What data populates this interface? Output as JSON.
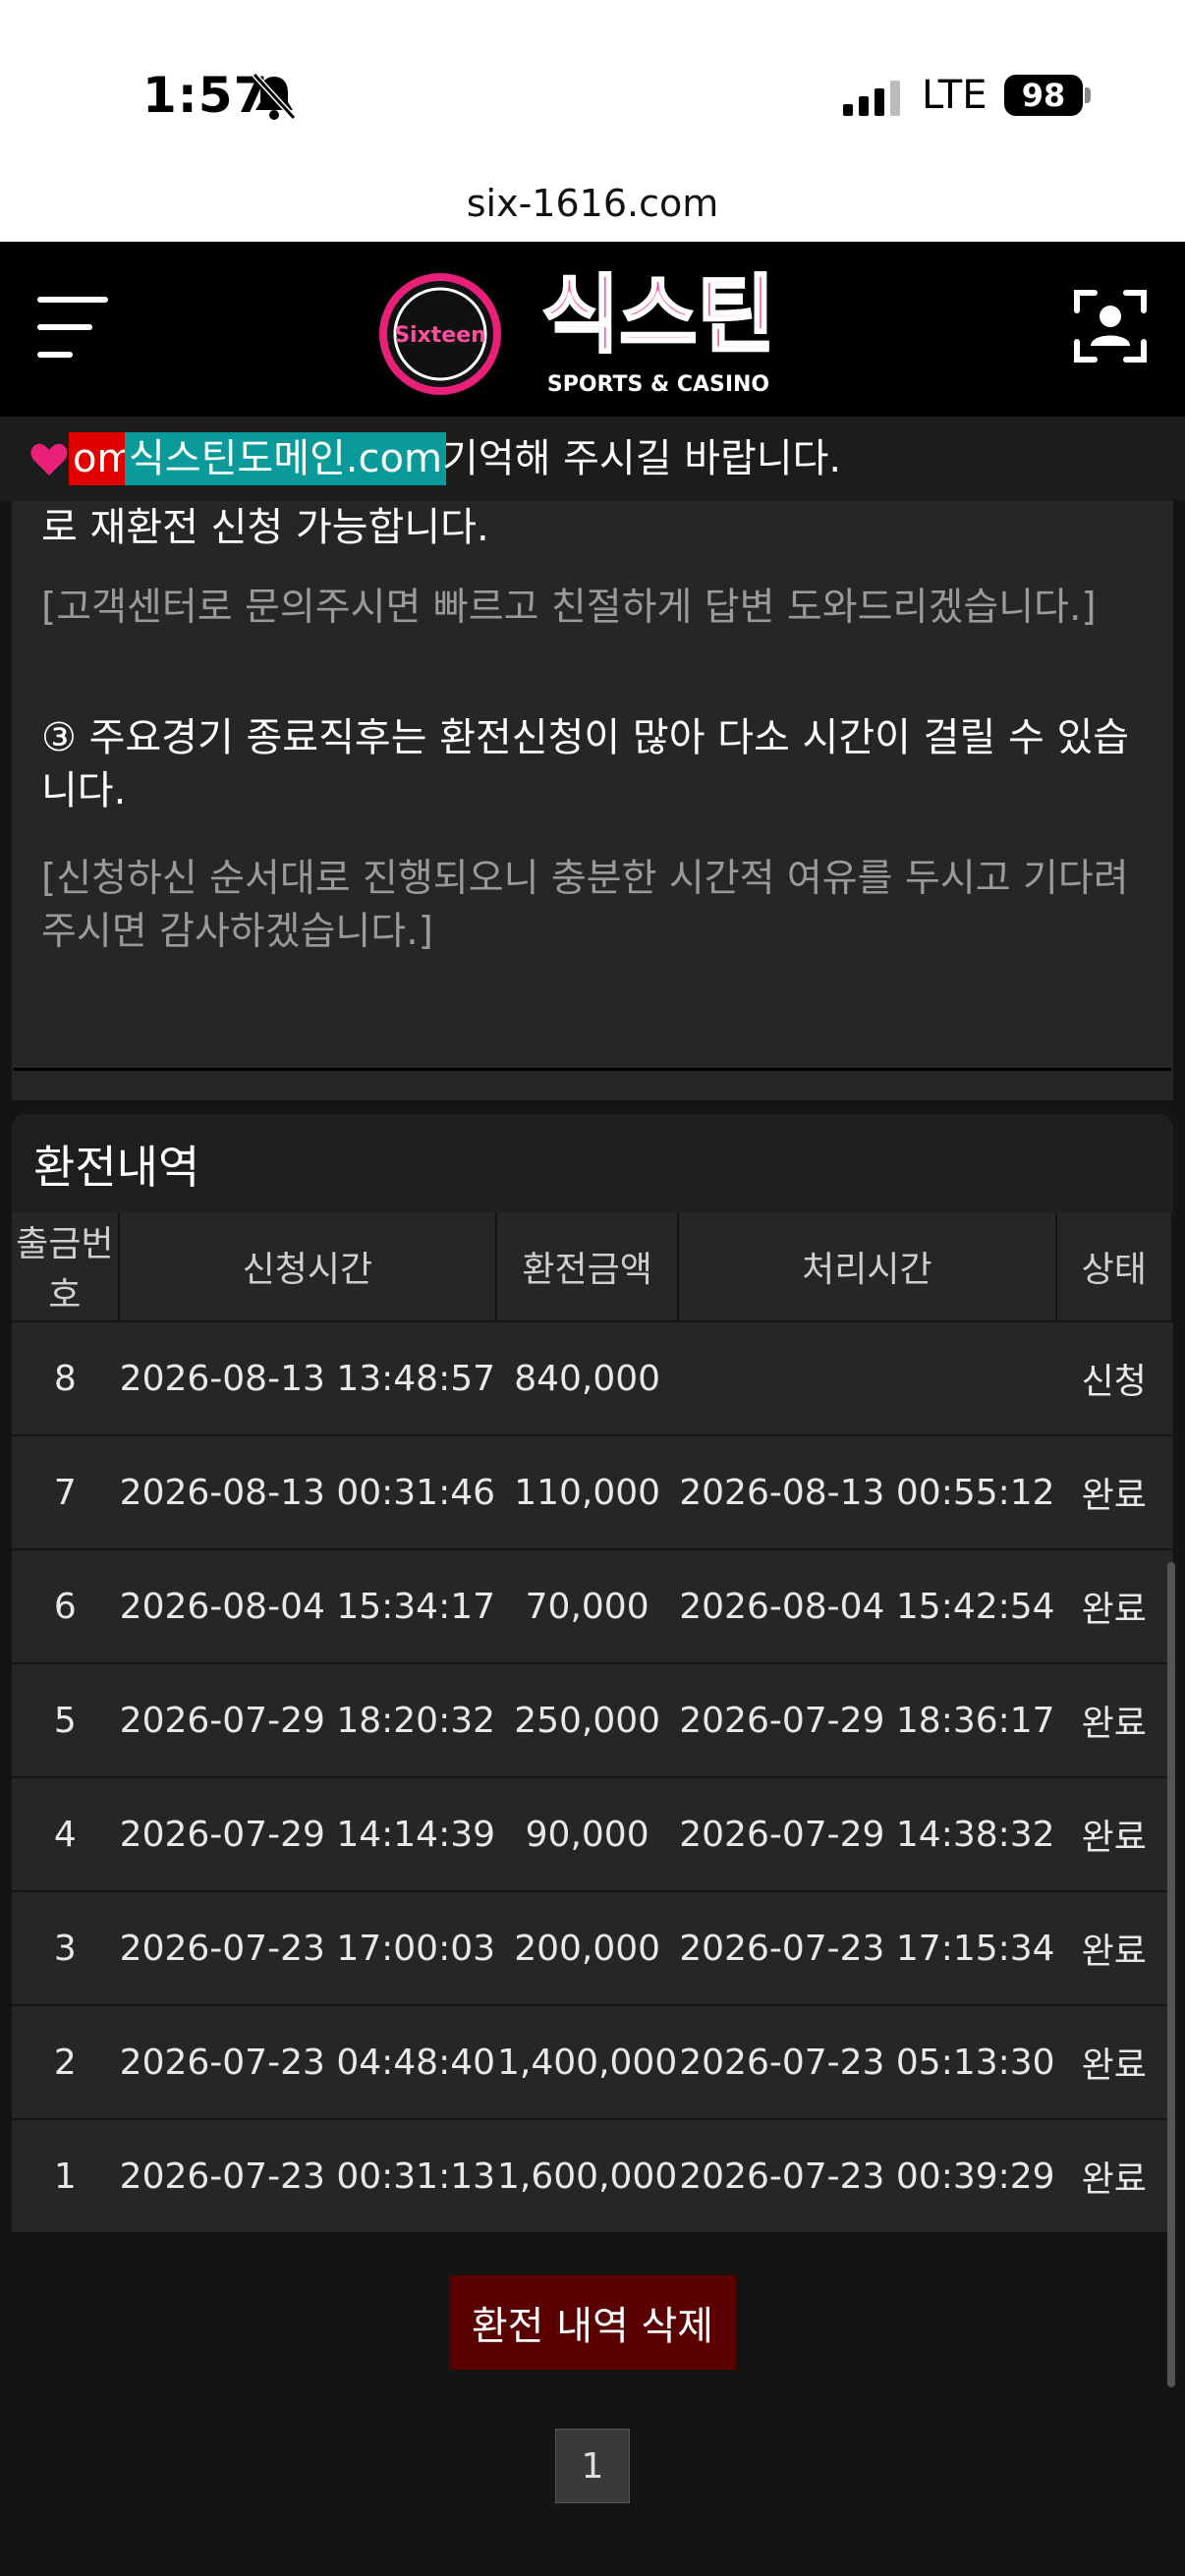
{
  "status_bar": {
    "time": "1:57",
    "network": "LTE",
    "battery": "98"
  },
  "browser": {
    "url": "six-1616.com"
  },
  "header": {
    "logo_badge": "Sixteen",
    "logo_title": "식스틴",
    "logo_subtitle": "SPORTS & CASINO"
  },
  "ticker": {
    "fragment": "om",
    "domain": "식스틴도메인.com",
    "message": "기억해 주시길 바랍니다."
  },
  "info": {
    "line_top": "로 재환전 신청 가능합니다.",
    "note_1": "[고객센터로 문의주시면 빠르고 친절하게 답변 도와드리겠습니다.]",
    "point_3": "③ 주요경기 종료직후는 환전신청이 많아 다소 시간이 걸릴 수 있습니다.",
    "note_3": "[신청하신 순서대로 진행되오니 충분한 시간적 여유를 두시고 기다려 주시면 감사하겠습니다.]"
  },
  "history": {
    "title": "환전내역",
    "columns": [
      "출금번호",
      "신청시간",
      "환전금액",
      "처리시간",
      "상태"
    ],
    "rows": [
      {
        "no": "8",
        "requested": "2026-08-13 13:48:57",
        "amount": "840,000",
        "processed": "",
        "status": "신청"
      },
      {
        "no": "7",
        "requested": "2026-08-13 00:31:46",
        "amount": "110,000",
        "processed": "2026-08-13 00:55:12",
        "status": "완료"
      },
      {
        "no": "6",
        "requested": "2026-08-04 15:34:17",
        "amount": "70,000",
        "processed": "2026-08-04 15:42:54",
        "status": "완료"
      },
      {
        "no": "5",
        "requested": "2026-07-29 18:20:32",
        "amount": "250,000",
        "processed": "2026-07-29 18:36:17",
        "status": "완료"
      },
      {
        "no": "4",
        "requested": "2026-07-29 14:14:39",
        "amount": "90,000",
        "processed": "2026-07-29 14:38:32",
        "status": "완료"
      },
      {
        "no": "3",
        "requested": "2026-07-23 17:00:03",
        "amount": "200,000",
        "processed": "2026-07-23 17:15:34",
        "status": "완료"
      },
      {
        "no": "2",
        "requested": "2026-07-23 04:48:40",
        "amount": "1,400,000",
        "processed": "2026-07-23 05:13:30",
        "status": "완료"
      },
      {
        "no": "1",
        "requested": "2026-07-23 00:31:13",
        "amount": "1,600,000",
        "processed": "2026-07-23 00:39:29",
        "status": "완료"
      }
    ],
    "delete_label": "환전 내역 삭제",
    "page": "1"
  },
  "colors": {
    "accent_pink": "#e8207a",
    "ticker_domain_bg": "#0a9a9a",
    "delete_bg": "#5a0000"
  },
  "icons": [
    "bell-slash-icon",
    "signal-icon",
    "battery-icon",
    "menu-icon",
    "user-scan-icon",
    "heart-icon"
  ]
}
